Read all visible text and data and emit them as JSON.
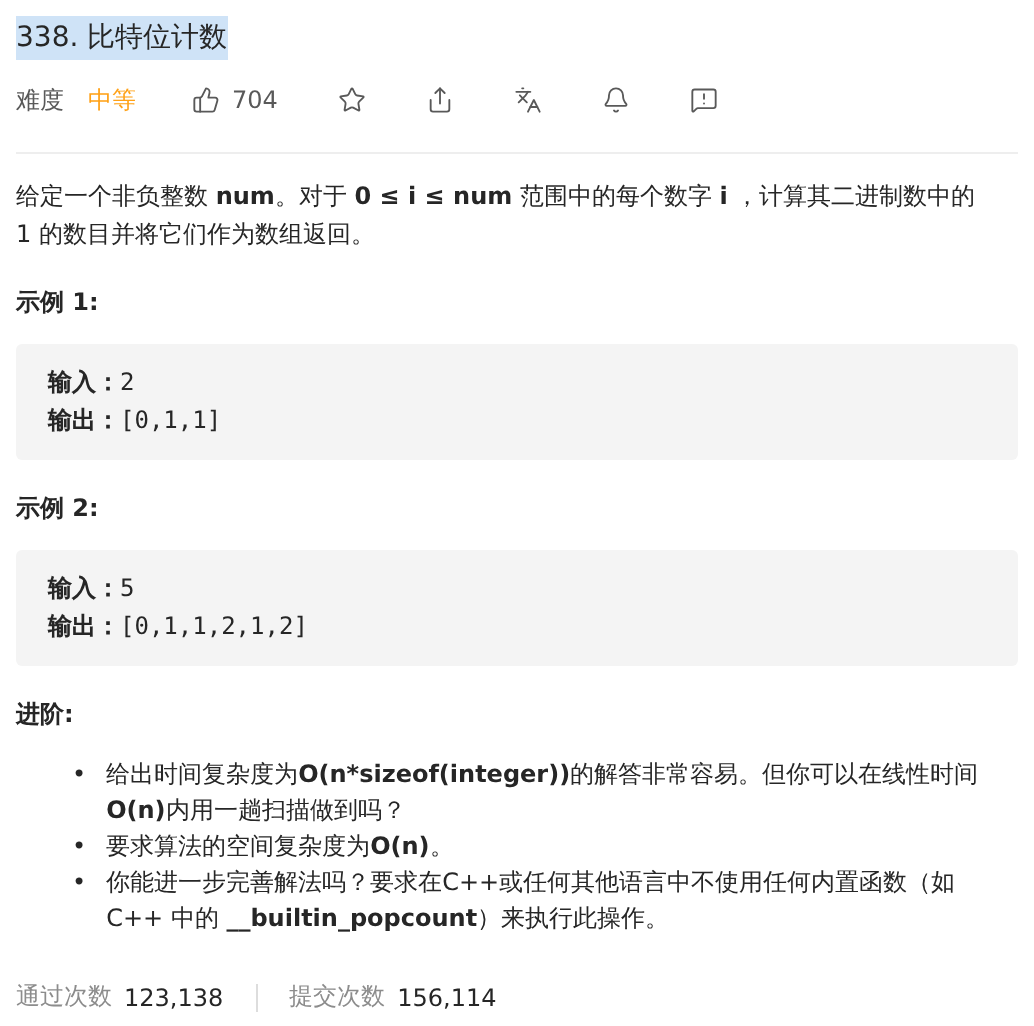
{
  "title": "338. 比特位计数",
  "meta": {
    "difficulty_label": "难度",
    "difficulty": "中等",
    "likes": "704"
  },
  "description": "给定一个非负整数 **num**。对于 **0 ≤ i ≤ num** 范围中的每个数字 **i** ，计算其二进制数中的 1 的数目并将它们作为数组返回。",
  "examples": [
    {
      "heading": "示例 1:",
      "lines": [
        {
          "label": "输入：",
          "value": "2"
        },
        {
          "label": "输出：",
          "value": "[0,1,1]"
        }
      ]
    },
    {
      "heading": "示例 2:",
      "lines": [
        {
          "label": "输入：",
          "value": "5"
        },
        {
          "label": "输出：",
          "value": "[0,1,1,2,1,2]"
        }
      ]
    }
  ],
  "advanced": {
    "heading": "进阶:",
    "items": [
      {
        "bullet": "•",
        "text": "给出时间复杂度为**O(n*sizeof(integer))**的解答非常容易。但你可以在线性时间**O(n)**内用一趟扫描做到吗？"
      },
      {
        "bullet": "•",
        "text": "要求算法的空间复杂度为**O(n)**。"
      },
      {
        "bullet": "•",
        "text": "你能进一步完善解法吗？要求在C++或任何其他语言中不使用任何内置函数（如 C++ 中的 **__builtin_popcount**）来执行此操作。"
      }
    ]
  },
  "stats": [
    {
      "label": "通过次数",
      "value": "123,138"
    },
    {
      "label": "提交次数",
      "value": "156,114"
    }
  ]
}
